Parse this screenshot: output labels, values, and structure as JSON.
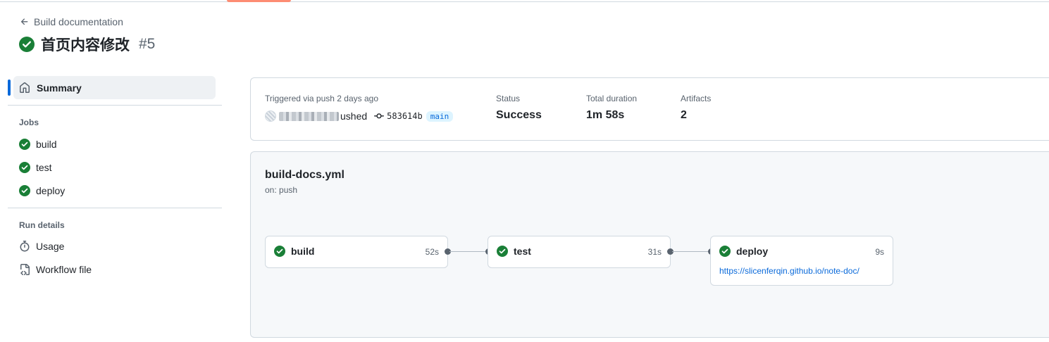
{
  "header": {
    "back_label": "Build documentation",
    "run_title": "首页内容修改",
    "run_number": "#5"
  },
  "sidebar": {
    "summary_label": "Summary",
    "jobs_title": "Jobs",
    "jobs": [
      {
        "label": "build"
      },
      {
        "label": "test"
      },
      {
        "label": "deploy"
      }
    ],
    "run_details_title": "Run details",
    "details": [
      {
        "label": "Usage",
        "icon": "stopwatch-icon"
      },
      {
        "label": "Workflow file",
        "icon": "file-code-icon"
      }
    ]
  },
  "summary": {
    "trigger_label": "Triggered via push 2 days ago",
    "pushed_text": "ushed",
    "commit_sha": "583614b",
    "branch": "main",
    "status_label": "Status",
    "status_value": "Success",
    "duration_label": "Total duration",
    "duration_value": "1m 58s",
    "artifacts_label": "Artifacts",
    "artifacts_value": "2"
  },
  "workflow": {
    "file_name": "build-docs.yml",
    "trigger": "on: push",
    "jobs": [
      {
        "name": "build",
        "duration": "52s"
      },
      {
        "name": "test",
        "duration": "31s"
      },
      {
        "name": "deploy",
        "duration": "9s",
        "link": "https://slicenferqin.github.io/note-doc/"
      }
    ]
  },
  "colors": {
    "success": "#1a7f37",
    "accent": "#0969da",
    "tab_underline": "#fd8c73"
  }
}
